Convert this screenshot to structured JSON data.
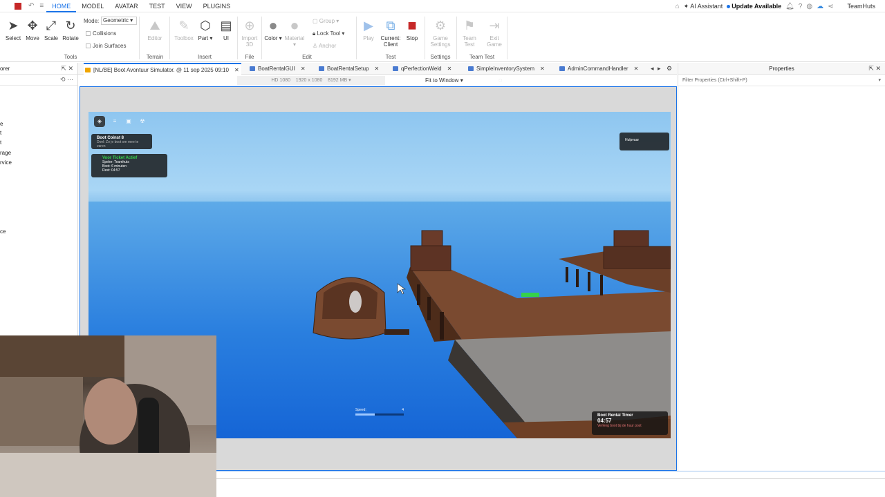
{
  "menu": {
    "tabs": [
      "HOME",
      "MODEL",
      "AVATAR",
      "TEST",
      "VIEW",
      "PLUGINS"
    ],
    "active_tab": "HOME",
    "ai_assistant": "AI Assistant",
    "update": "Update Available",
    "user": "TeamHuts"
  },
  "ribbon": {
    "tools": {
      "select": "Select",
      "move": "Move",
      "scale": "Scale",
      "rotate": "Rotate",
      "mode_label": "Mode:",
      "mode_value": "Geometric",
      "collisions": "Collisions",
      "join_surfaces": "Join Surfaces",
      "group_label": "Tools"
    },
    "terrain": {
      "editor": "Editor",
      "group_label": "Terrain"
    },
    "insert": {
      "toolbox": "Toolbox",
      "part": "Part",
      "ui": "UI",
      "group_label": "Insert"
    },
    "file": {
      "import3d": "Import 3D",
      "group_label": "File"
    },
    "edit": {
      "color": "Color",
      "material": "Material",
      "group": "Group",
      "lock_tool": "Lock Tool",
      "anchor": "Anchor",
      "group_label": "Edit"
    },
    "test": {
      "play": "Play",
      "current_client": "Current: Client",
      "stop": "Stop",
      "group_label": "Test"
    },
    "settings": {
      "game_settings": "Game Settings",
      "group_label": "Settings"
    },
    "team_test": {
      "team_test": "Team Test",
      "exit_game": "Exit Game",
      "group_label": "Team Test"
    }
  },
  "explorer": {
    "title": "orer",
    "items": [
      "e",
      "t",
      "t",
      "rage",
      "rvice",
      "ce"
    ]
  },
  "tabs": [
    {
      "label": "[NL/BE] Boot Avontuur Simulator. @ 11 sep 2025 09:10",
      "active": true
    },
    {
      "label": "BoatRentalGUI",
      "active": false
    },
    {
      "label": "BoatRentalSetup",
      "active": false
    },
    {
      "label": "qPerfectionWeld",
      "active": false
    },
    {
      "label": "SimpleInventorySystem",
      "active": false
    },
    {
      "label": "AdminCommandHandler",
      "active": false
    }
  ],
  "viewport": {
    "device": "HD 1080",
    "resolution": "1920 x 1080",
    "memory": "8192 MB",
    "fit": "Fit to Window"
  },
  "hud": {
    "coins_title": "Boot Coinst 8",
    "coins_sub": "Doel: Zo je boot om mee te varen",
    "ticket_title": "Voor Ticket Actief",
    "ticket_lines": [
      "Speler: Teamhuts",
      "Boot: 6 minuten",
      "Rest: 04:57"
    ],
    "help_label": "Hulpvaar",
    "speed_label": "Speed:",
    "speed_value": "4",
    "timer_title": "Boot Rental Timer",
    "timer_value": "04:57",
    "timer_sub": "Verleng boot bij de huur post"
  },
  "properties": {
    "title": "Properties",
    "filter_placeholder": "Filter Properties (Ctrl+Shift+P)"
  },
  "colors": {
    "accent": "#1a73e8",
    "stop": "#c62828",
    "ticket_green": "#35d24a"
  }
}
